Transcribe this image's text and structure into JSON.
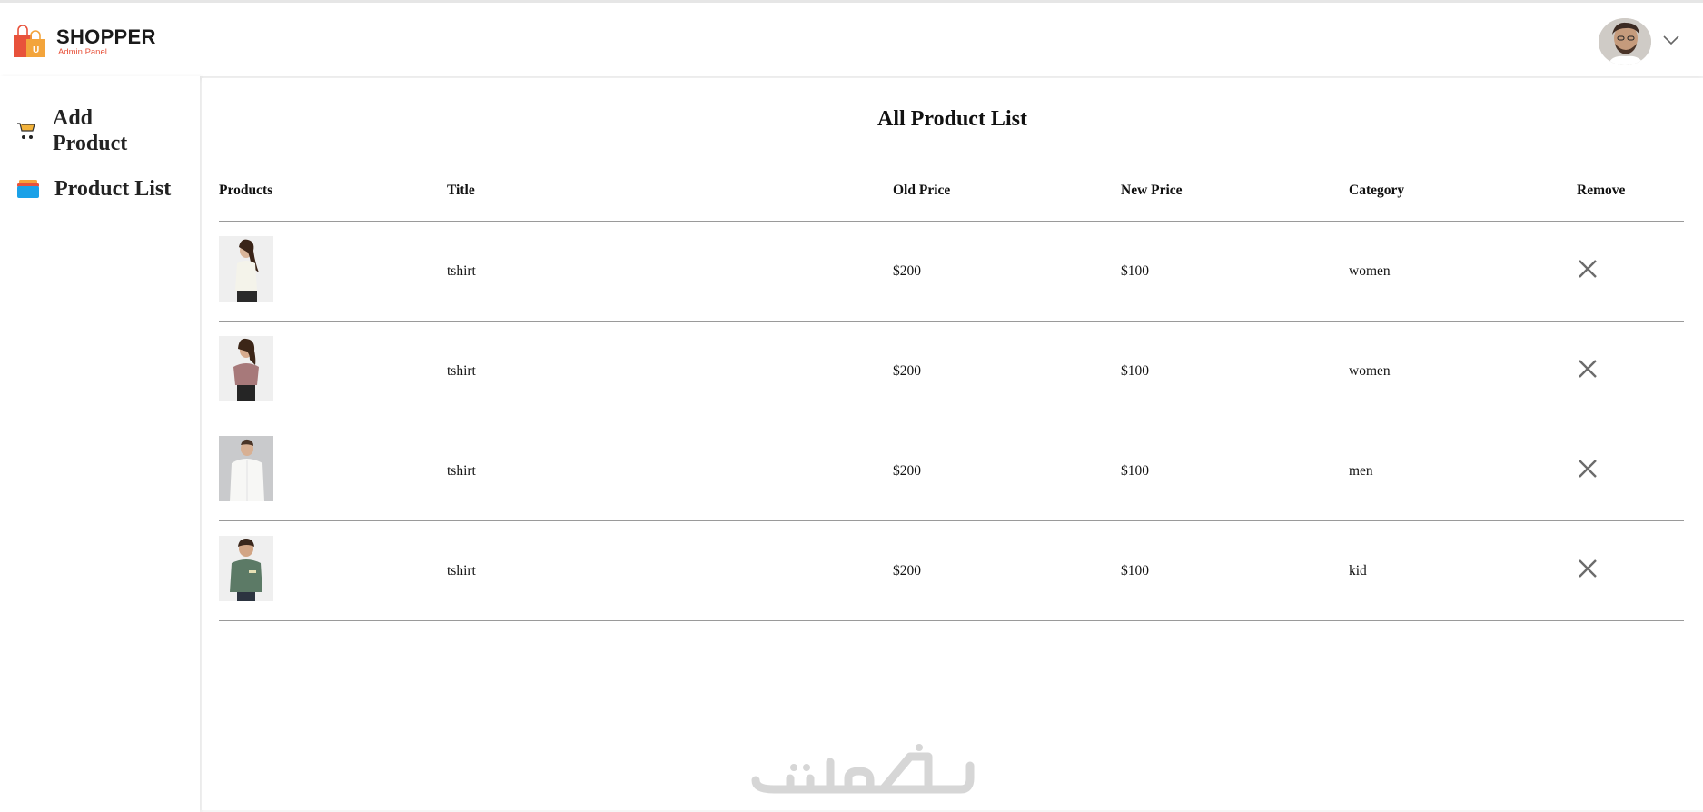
{
  "brand": {
    "name": "SHOPPER",
    "subtitle": "Admin Panel"
  },
  "sidebar": {
    "items": [
      {
        "label": "Add Product",
        "icon": "cart-icon"
      },
      {
        "label": "Product List",
        "icon": "list-icon"
      }
    ]
  },
  "main": {
    "title": "All Product List",
    "columns": [
      "Products",
      "Title",
      "Old Price",
      "New Price",
      "Category",
      "Remove"
    ],
    "rows": [
      {
        "title": "tshirt",
        "old_price": "$200",
        "new_price": "$100",
        "category": "women"
      },
      {
        "title": "tshirt",
        "old_price": "$200",
        "new_price": "$100",
        "category": "women"
      },
      {
        "title": "tshirt",
        "old_price": "$200",
        "new_price": "$100",
        "category": "men"
      },
      {
        "title": "tshirt",
        "old_price": "$200",
        "new_price": "$100",
        "category": "kid"
      }
    ]
  },
  "colors": {
    "accent": "#e8523b",
    "divider": "#9a9a9a",
    "remove_icon": "#6b6b6b"
  },
  "watermark": {
    "text": "خمسات"
  }
}
